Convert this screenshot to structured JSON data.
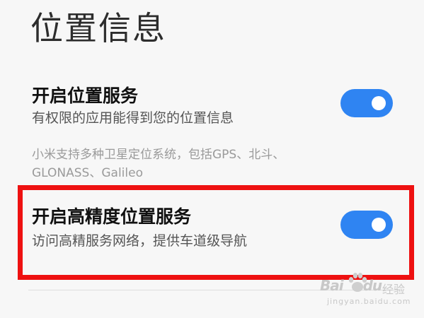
{
  "page": {
    "title": "位置信息"
  },
  "location_service": {
    "title": "开启位置服务",
    "description": "有权限的应用能得到您的位置信息",
    "enabled": true
  },
  "satellite_note": {
    "line1": "小米支持多种卫星定位系统，包括GPS、北斗、",
    "line2": "GLONASS、Galileo"
  },
  "high_precision_service": {
    "title": "开启高精度位置服务",
    "description": "访问高精服务网络，提供车道级导航",
    "enabled": true
  },
  "watermark": {
    "logo": "Bai",
    "logo_suffix": "du",
    "site": "经验",
    "url": "jingyan.baidu.com"
  },
  "colors": {
    "toggle_on": "#2f84f2",
    "highlight_border": "#ee1111",
    "background": "#f7f7f7"
  },
  "icons": {
    "watermark_paw": "paw-icon"
  }
}
